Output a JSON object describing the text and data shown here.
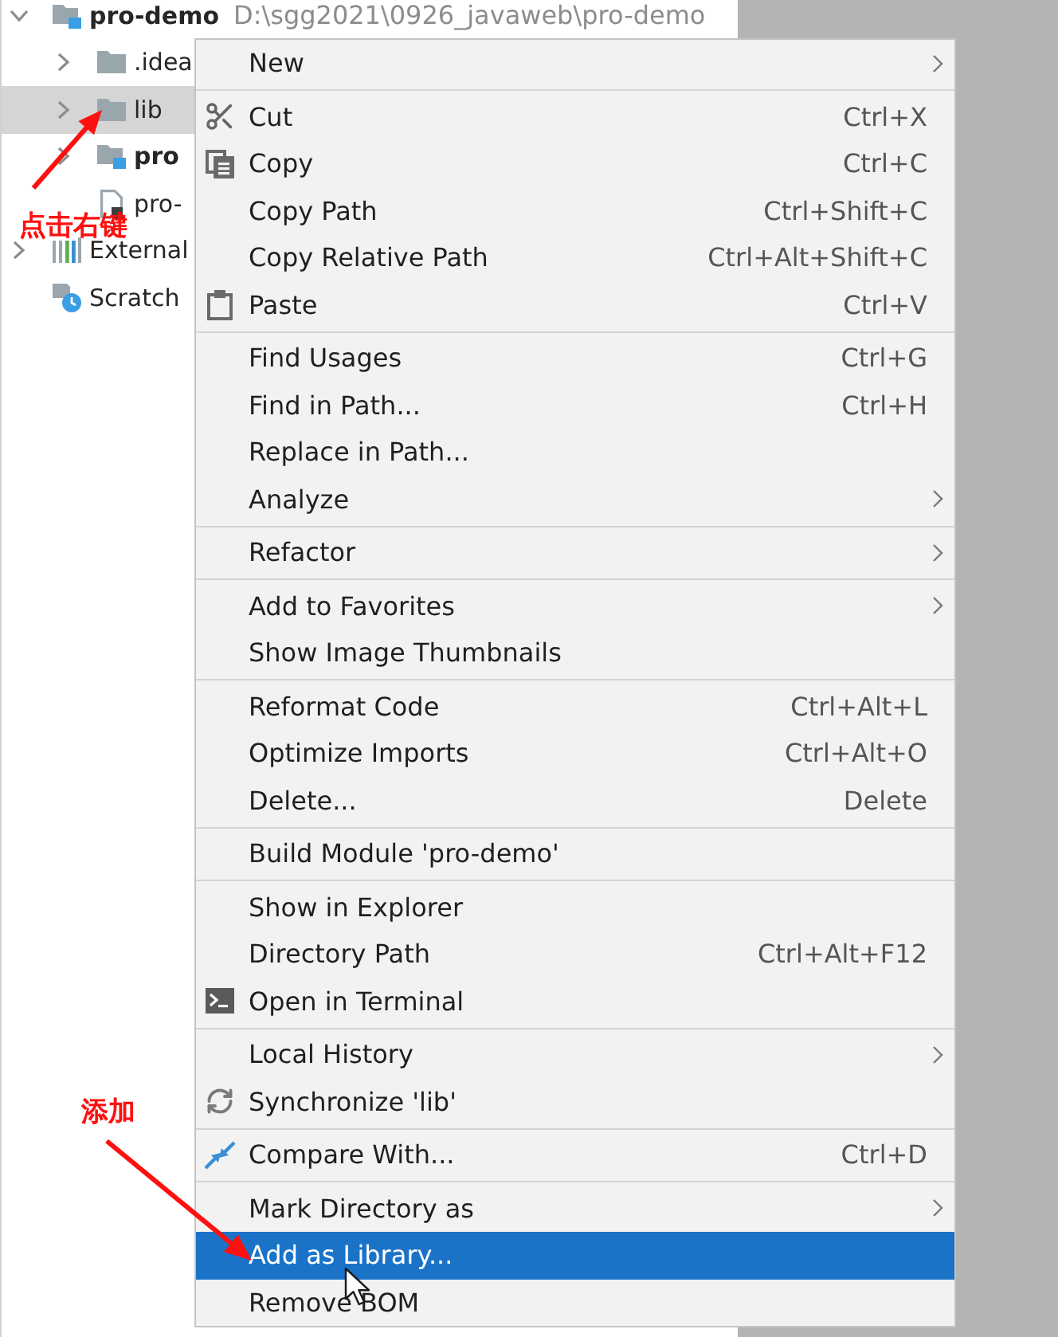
{
  "project_tree": {
    "items": [
      {
        "kind": "module",
        "label": "pro-demo",
        "path": "D:\\sgg2021\\0926_javaweb\\pro-demo",
        "expanded": true,
        "selected": false,
        "children": [
          {
            "kind": "folder",
            "label": ".idea",
            "expanded": false,
            "selected": false
          },
          {
            "kind": "folder",
            "label": "lib",
            "expanded": false,
            "selected": true
          },
          {
            "kind": "module",
            "label": "pro",
            "expanded": false,
            "selected": false
          },
          {
            "kind": "file",
            "label": "pro-",
            "selected": false
          }
        ]
      },
      {
        "kind": "libraries",
        "label": "External",
        "expanded": false,
        "selected": false
      },
      {
        "kind": "scratches",
        "label": "Scratch",
        "selected": false
      }
    ]
  },
  "context_menu": {
    "groups": [
      {
        "items": [
          {
            "kind": "text",
            "label": "New",
            "submenu": true,
            "selected": false
          }
        ]
      },
      {
        "items": [
          {
            "kind": "cut",
            "label": "Cut",
            "shortcut": "Ctrl+X",
            "submenu": false,
            "selected": false
          },
          {
            "kind": "copy",
            "label": "Copy",
            "shortcut": "Ctrl+C",
            "submenu": false,
            "selected": false
          },
          {
            "kind": "text",
            "label": "Copy Path",
            "shortcut": "Ctrl+Shift+C",
            "submenu": false,
            "selected": false
          },
          {
            "kind": "text",
            "label": "Copy Relative Path",
            "shortcut": "Ctrl+Alt+Shift+C",
            "submenu": false,
            "selected": false
          },
          {
            "kind": "paste",
            "label": "Paste",
            "shortcut": "Ctrl+V",
            "submenu": false,
            "selected": false
          }
        ]
      },
      {
        "items": [
          {
            "kind": "text",
            "label": "Find Usages",
            "shortcut": "Ctrl+G",
            "submenu": false,
            "selected": false
          },
          {
            "kind": "text",
            "label": "Find in Path...",
            "shortcut": "Ctrl+H",
            "submenu": false,
            "selected": false
          },
          {
            "kind": "text",
            "label": "Replace in Path...",
            "submenu": false,
            "selected": false
          },
          {
            "kind": "text",
            "label": "Analyze",
            "submenu": true,
            "selected": false
          }
        ]
      },
      {
        "items": [
          {
            "kind": "text",
            "label": "Refactor",
            "submenu": true,
            "selected": false
          }
        ]
      },
      {
        "items": [
          {
            "kind": "text",
            "label": "Add to Favorites",
            "submenu": true,
            "selected": false
          },
          {
            "kind": "text",
            "label": "Show Image Thumbnails",
            "submenu": false,
            "selected": false
          }
        ]
      },
      {
        "items": [
          {
            "kind": "text",
            "label": "Reformat Code",
            "shortcut": "Ctrl+Alt+L",
            "submenu": false,
            "selected": false
          },
          {
            "kind": "text",
            "label": "Optimize Imports",
            "shortcut": "Ctrl+Alt+O",
            "submenu": false,
            "selected": false
          },
          {
            "kind": "text",
            "label": "Delete...",
            "shortcut": "Delete",
            "submenu": false,
            "selected": false
          }
        ]
      },
      {
        "items": [
          {
            "kind": "text",
            "label": "Build Module 'pro-demo'",
            "submenu": false,
            "selected": false
          }
        ]
      },
      {
        "items": [
          {
            "kind": "text",
            "label": "Show in Explorer",
            "submenu": false,
            "selected": false
          },
          {
            "kind": "text",
            "label": "Directory Path",
            "shortcut": "Ctrl+Alt+F12",
            "submenu": false,
            "selected": false
          },
          {
            "kind": "terminal",
            "label": "Open in Terminal",
            "submenu": false,
            "selected": false
          }
        ]
      },
      {
        "items": [
          {
            "kind": "text",
            "label": "Local History",
            "submenu": true,
            "selected": false
          },
          {
            "kind": "synchronize",
            "label": "Synchronize 'lib'",
            "submenu": false,
            "selected": false
          }
        ]
      },
      {
        "items": [
          {
            "kind": "compare",
            "label": "Compare With...",
            "shortcut": "Ctrl+D",
            "submenu": false,
            "selected": false
          }
        ]
      },
      {
        "items": [
          {
            "kind": "text",
            "label": "Mark Directory as",
            "submenu": true,
            "selected": false
          },
          {
            "kind": "text",
            "label": "Add as Library...",
            "submenu": false,
            "selected": true
          },
          {
            "kind": "text",
            "label": "Remove BOM",
            "submenu": false,
            "selected": false
          }
        ]
      }
    ]
  },
  "annotations": [
    {
      "label": "点击右键"
    },
    {
      "label": "添加"
    }
  ]
}
